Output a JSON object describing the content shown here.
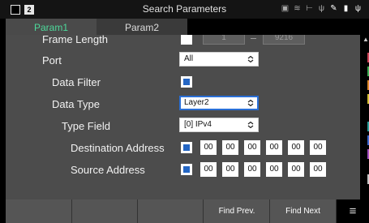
{
  "title_bar": {
    "title": "Search Parameters",
    "app_badge": "2",
    "status_icons": [
      "printer-icon",
      "wifi-icon",
      "network-icon",
      "usb-icon",
      "pen-icon",
      "sd-card-icon",
      "power-plug-icon"
    ]
  },
  "tabs": [
    {
      "label": "Param1",
      "active": true
    },
    {
      "label": "Param2",
      "active": false
    }
  ],
  "form": {
    "frame_length": {
      "label": "Frame Length",
      "checked": false,
      "min": "1",
      "max": "9216"
    },
    "port": {
      "label": "Port",
      "value": "All"
    },
    "data_filter": {
      "label": "Data Filter",
      "checked": true
    },
    "data_type": {
      "label": "Data Type",
      "value": "Layer2",
      "focused": true
    },
    "type_field": {
      "label": "Type Field",
      "value": "[0] IPv4"
    },
    "destination_address": {
      "label": "Destination Address",
      "checked": true,
      "octets": [
        "00",
        "00",
        "00",
        "00",
        "00",
        "00"
      ]
    },
    "source_address": {
      "label": "Source Address",
      "checked": true,
      "octets": [
        "00",
        "00",
        "00",
        "00",
        "00",
        "00"
      ]
    }
  },
  "side_strip_colors": [
    "#d2455a",
    "#3fae55",
    "#e08a2a",
    "#d8c236",
    "#2c9f9a",
    "#3c68d0",
    "#a54fc2",
    "#c8c8c8"
  ],
  "function_keys": [
    "",
    "",
    "",
    "",
    "Find Prev.",
    "Find Next"
  ],
  "function_key_icon": "list-filter-icon"
}
